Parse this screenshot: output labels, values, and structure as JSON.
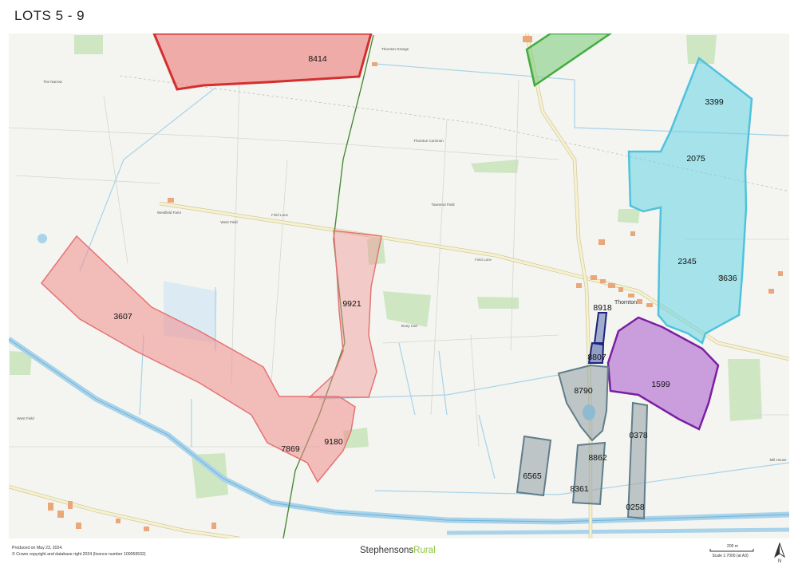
{
  "title": "LOTS 5 - 9",
  "map": {
    "plots": [
      {
        "id": "8414",
        "lot_color": "#d32f2f"
      },
      {
        "id": "3607",
        "lot_color": "#e57373"
      },
      {
        "id": "9921",
        "lot_color": "#e57373"
      },
      {
        "id": "7869",
        "lot_color": "#e57373"
      },
      {
        "id": "9180",
        "lot_color": "#e57373"
      },
      {
        "id": "3399",
        "lot_color": "#4fc3dc"
      },
      {
        "id": "2075",
        "lot_color": "#4fc3dc"
      },
      {
        "id": "2345",
        "lot_color": "#4fc3dc"
      },
      {
        "id": "3636",
        "lot_color": "#4fc3dc"
      },
      {
        "id": "1599",
        "lot_color": "#7b1fa2"
      },
      {
        "id": "8918",
        "lot_color": "#1a237e"
      },
      {
        "id": "8807",
        "lot_color": "#1a237e"
      },
      {
        "id": "8790",
        "lot_color": "#607d8b"
      },
      {
        "id": "8862",
        "lot_color": "#607d8b"
      },
      {
        "id": "6565",
        "lot_color": "#607d8b"
      },
      {
        "id": "8361",
        "lot_color": "#607d8b"
      },
      {
        "id": "0378",
        "lot_color": "#607d8b"
      },
      {
        "id": "0258",
        "lot_color": "#607d8b"
      }
    ],
    "place_names": {
      "the_narrow": "The Narrow",
      "west_field_top": "West Field",
      "west_field_bottom": "West Field",
      "thornton_common": "Thornton Common",
      "townend_field": "Townend Field",
      "sicey_carr": "Sicey Carr",
      "westfield_farm": "Westfield Farm",
      "thornton_grange": "Thornton Grange",
      "mill_house": "Mill House",
      "village": "Thornton",
      "fleet_lane_1": "Field Lane",
      "fleet_lane_2": "Field Lane"
    }
  },
  "footer": {
    "produced": "Produced on May 23, 2024.",
    "copyright": "© Crown copyright and database right 2024 (licence number 100059532)",
    "brand_main": "Stephensons",
    "brand_accent": "Rural",
    "scale_distance": "200 m",
    "scale_note": "Scale 1:7000 (at A3)",
    "north": "N"
  },
  "colors": {
    "lot5_red": "#d32f2f",
    "lot6_pink": "#e57373",
    "lot7_cyan": "#4fc3dc",
    "lot8_purple": "#7b1fa2",
    "lot9_grey": "#607d8b",
    "navy": "#1a237e",
    "green_outline": "#3fae3f"
  }
}
